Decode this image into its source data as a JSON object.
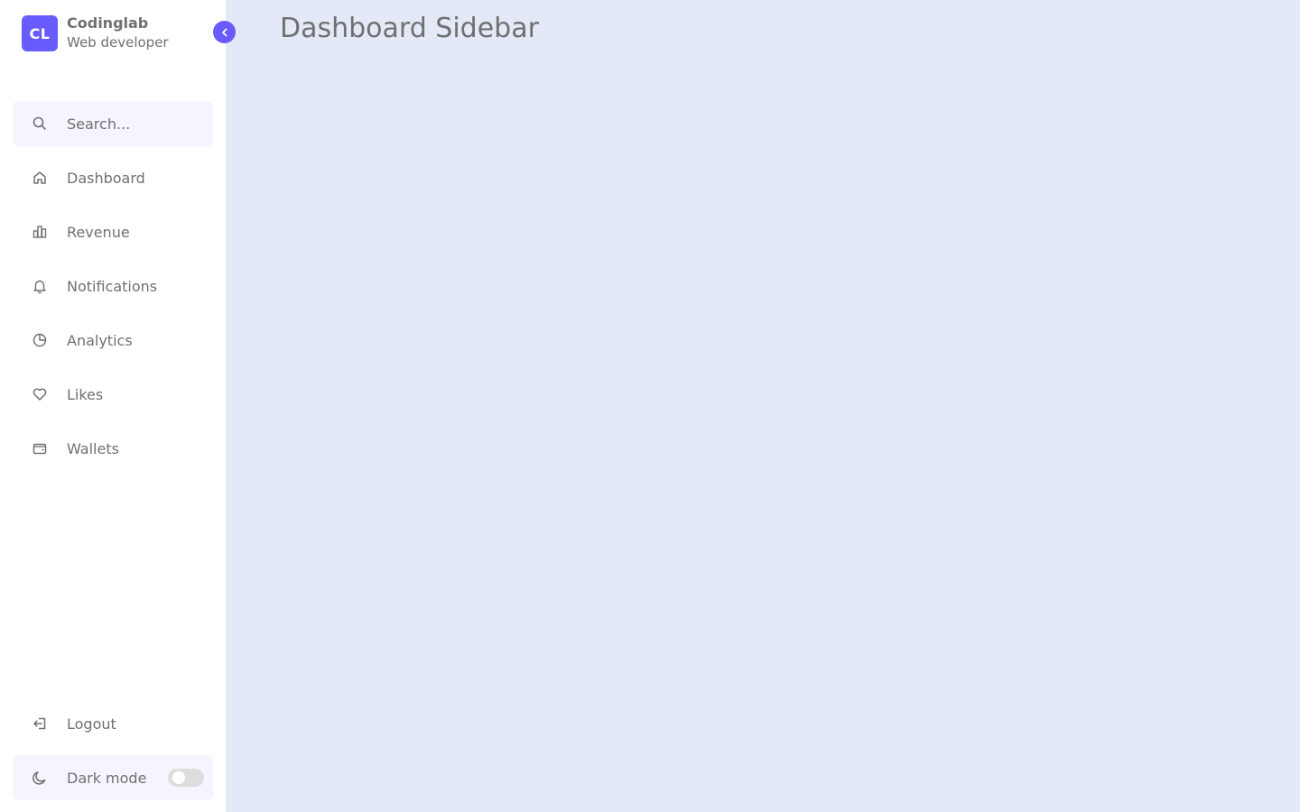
{
  "brand": {
    "logo_text": "CL",
    "name": "Codinglab",
    "role": "Web developer"
  },
  "sidebar_toggle_icon": "chevron-left-icon",
  "search": {
    "placeholder": "Search...",
    "icon": "search-icon"
  },
  "menu": [
    {
      "label": "Dashboard",
      "icon": "home-icon"
    },
    {
      "label": "Revenue",
      "icon": "bar-chart-icon"
    },
    {
      "label": "Notifications",
      "icon": "bell-icon"
    },
    {
      "label": "Analytics",
      "icon": "pie-chart-icon"
    },
    {
      "label": "Likes",
      "icon": "heart-icon"
    },
    {
      "label": "Wallets",
      "icon": "wallet-icon"
    }
  ],
  "bottom": {
    "logout_label": "Logout",
    "logout_icon": "logout-icon",
    "darkmode_label": "Dark mode",
    "darkmode_icon": "moon-icon",
    "darkmode_enabled": false
  },
  "main": {
    "title": "Dashboard Sidebar"
  },
  "colors": {
    "accent": "#695CFE",
    "body_bg": "#E4E9F7",
    "sidebar_bg": "#FFFFFF",
    "text": "#707070",
    "search_bg": "#F6F5FF",
    "switch_bg": "#DDDDDD"
  }
}
